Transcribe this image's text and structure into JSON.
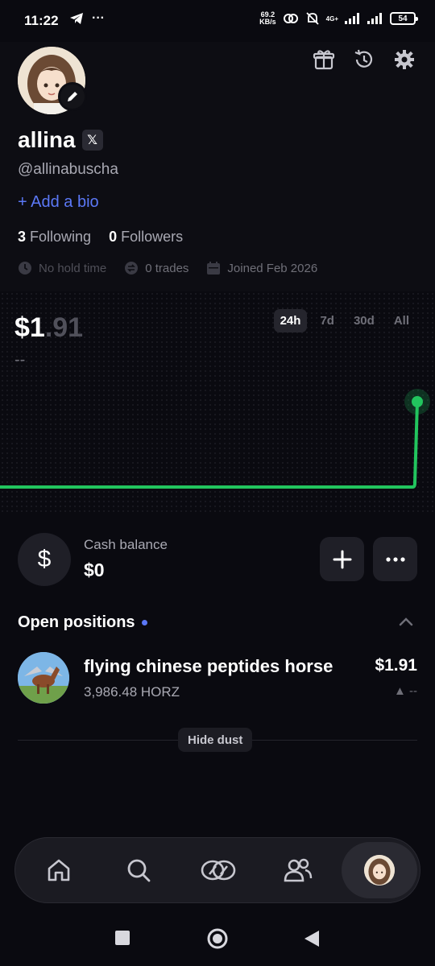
{
  "status_bar": {
    "time": "11:22",
    "net_speed_value": "69.2",
    "net_speed_unit": "KB/s",
    "network": "4G+",
    "battery": "54"
  },
  "profile": {
    "username": "allina",
    "handle": "@allinabuscha",
    "add_bio": "+ Add a bio",
    "following_count": "3",
    "following_label": "Following",
    "followers_count": "0",
    "followers_label": "Followers",
    "hold_time": "No hold time",
    "trades": "0 trades",
    "joined": "Joined Feb 2026"
  },
  "portfolio": {
    "value_main": "$1",
    "value_decimal": ".91",
    "change": "--",
    "ranges": [
      "24h",
      "7d",
      "30d",
      "All"
    ],
    "active_range": "24h",
    "accent": "#22c55e"
  },
  "cash": {
    "label": "Cash balance",
    "value": "$0",
    "icon": "$"
  },
  "positions": {
    "title": "Open positions",
    "items": [
      {
        "name": "flying chinese peptides horse",
        "amount": "3,986.48 HORZ",
        "value": "$1.91",
        "change": "▲ --"
      }
    ],
    "hide_dust": "Hide dust"
  },
  "colors": {
    "background": "#0a0a10",
    "link": "#5b78f6",
    "chart_line": "#22c55e"
  }
}
